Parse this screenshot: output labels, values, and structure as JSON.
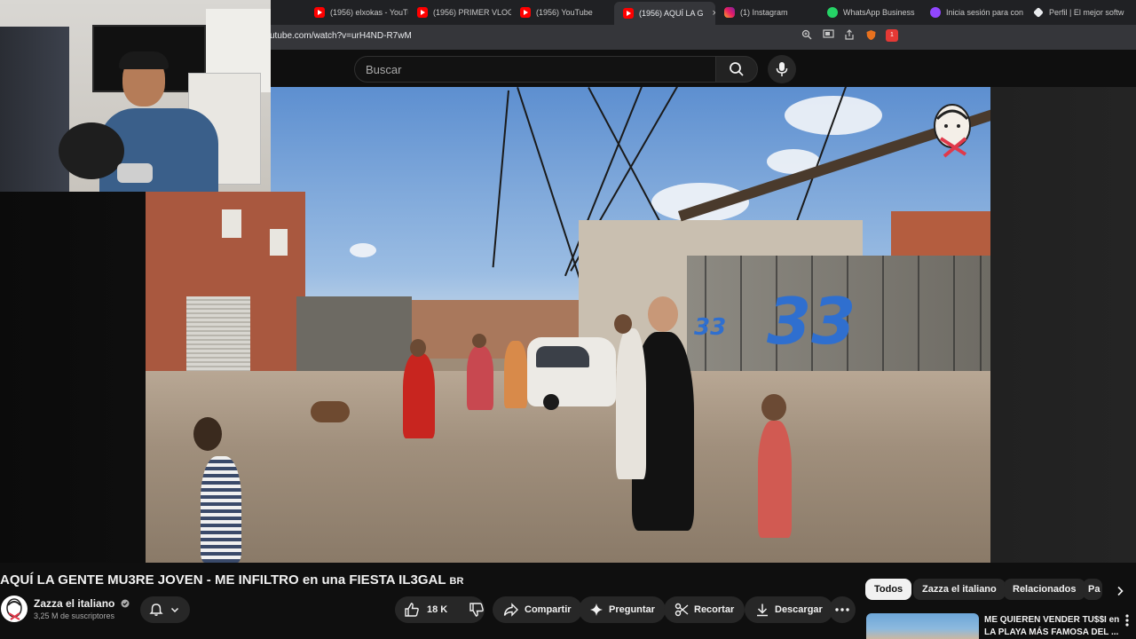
{
  "browser": {
    "tabs": [
      {
        "label": "(1956) elxokas - YouTu",
        "icon": "youtube-icon",
        "active": false
      },
      {
        "label": "(1956) PRIMER VLOG",
        "icon": "youtube-icon",
        "active": false
      },
      {
        "label": "(1956) YouTube",
        "icon": "youtube-icon",
        "active": false
      },
      {
        "label": "(1956) AQUÍ LA G",
        "icon": "youtube-icon",
        "active": true
      },
      {
        "label": "(1) Instagram",
        "icon": "instagram-icon",
        "active": false
      },
      {
        "label": "WhatsApp Business",
        "icon": "whatsapp-icon",
        "active": false
      },
      {
        "label": "Inicia sesión para con",
        "icon": "twitch-icon",
        "active": false
      },
      {
        "label": "Perfil | El mejor softw",
        "icon": "diamond-icon",
        "active": false
      }
    ],
    "close_glyph": "×",
    "url": "utube.com/watch?v=urH4ND-R7wM",
    "extension_badge": "1"
  },
  "masthead": {
    "search_placeholder": "Buscar"
  },
  "video": {
    "title": "AQUÍ LA GENTE MU3RE JOVEN - ME INFILTRO en una FIESTA IL3GAL",
    "title_flag": "BR",
    "graffiti": "33",
    "graffiti_small": "33"
  },
  "channel": {
    "name": "Zazza el italiano",
    "subscribers": "3,25 M de suscriptores"
  },
  "actions": {
    "likes": "18 K",
    "share": "Compartir",
    "ask": "Preguntar",
    "clip": "Recortar",
    "download": "Descargar"
  },
  "chips": [
    "Todos",
    "Zazza el italiano",
    "Relacionados",
    "Pa"
  ],
  "recommendation": {
    "title_line1": "ME QUIEREN VENDER TU$$I en",
    "title_line2": "LA PLAYA MÁS FAMOSA DEL ..."
  },
  "colors": {
    "background": "#0f0f0f",
    "chip_active": "#f1f1f1",
    "youtube_red": "#ff0000",
    "graffiti_blue": "#2f6fcf"
  }
}
